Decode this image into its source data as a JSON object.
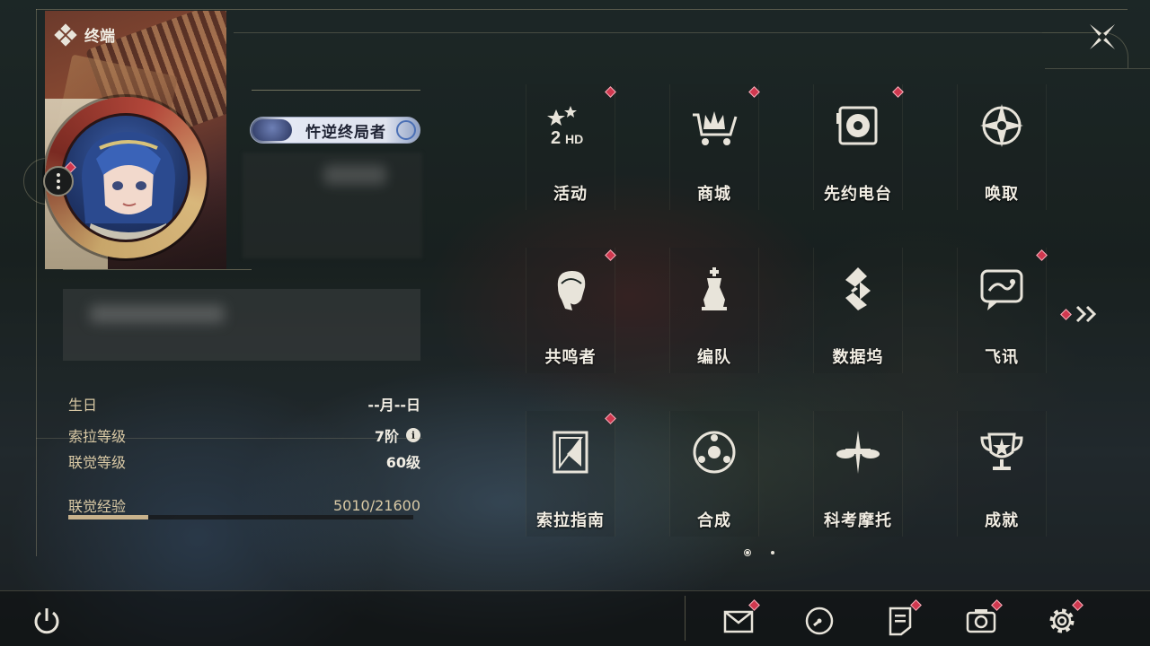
{
  "header": {
    "title": "终端"
  },
  "profile": {
    "title_plate": "忤逆终局者"
  },
  "stats": {
    "birthday_label": "生日",
    "birthday_value": "--月--日",
    "sola_level_label": "索拉等级",
    "sola_level_value": "7阶",
    "info_glyph": "i",
    "union_level_label": "联觉等级",
    "union_level_value": "60级",
    "union_exp_label": "联觉经验",
    "union_exp_value": "5010/21600",
    "union_exp_progress": 0.232
  },
  "menu": {
    "items": [
      {
        "label": "活动",
        "icon": "event-2hd-icon",
        "badge": true
      },
      {
        "label": "商城",
        "icon": "shop-cart-icon",
        "badge": true
      },
      {
        "label": "先约电台",
        "icon": "radio-icon",
        "badge": true
      },
      {
        "label": "唤取",
        "icon": "convene-compass-icon",
        "badge": false
      },
      {
        "label": "共鸣者",
        "icon": "resonator-head-icon",
        "badge": true
      },
      {
        "label": "编队",
        "icon": "team-chess-icon",
        "badge": false
      },
      {
        "label": "数据坞",
        "icon": "data-bank-icon",
        "badge": false
      },
      {
        "label": "飞讯",
        "icon": "message-bubble-icon",
        "badge": true
      },
      {
        "label": "索拉指南",
        "icon": "guidebook-icon",
        "badge": true
      },
      {
        "label": "合成",
        "icon": "synthesis-icon",
        "badge": false
      },
      {
        "label": "科考摩托",
        "icon": "motorcycle-icon",
        "badge": false
      },
      {
        "label": "成就",
        "icon": "trophy-icon",
        "badge": false
      }
    ]
  },
  "colors": {
    "badge": "#d0384f",
    "text": "#f2eee4",
    "label_gold": "#d9c9a5",
    "exp_fill": "#c8b28c"
  },
  "bottom_bar": {
    "icons": [
      "power-icon",
      "mail-icon",
      "clock-icon",
      "notes-icon",
      "camera-icon",
      "settings-gear-icon"
    ]
  }
}
